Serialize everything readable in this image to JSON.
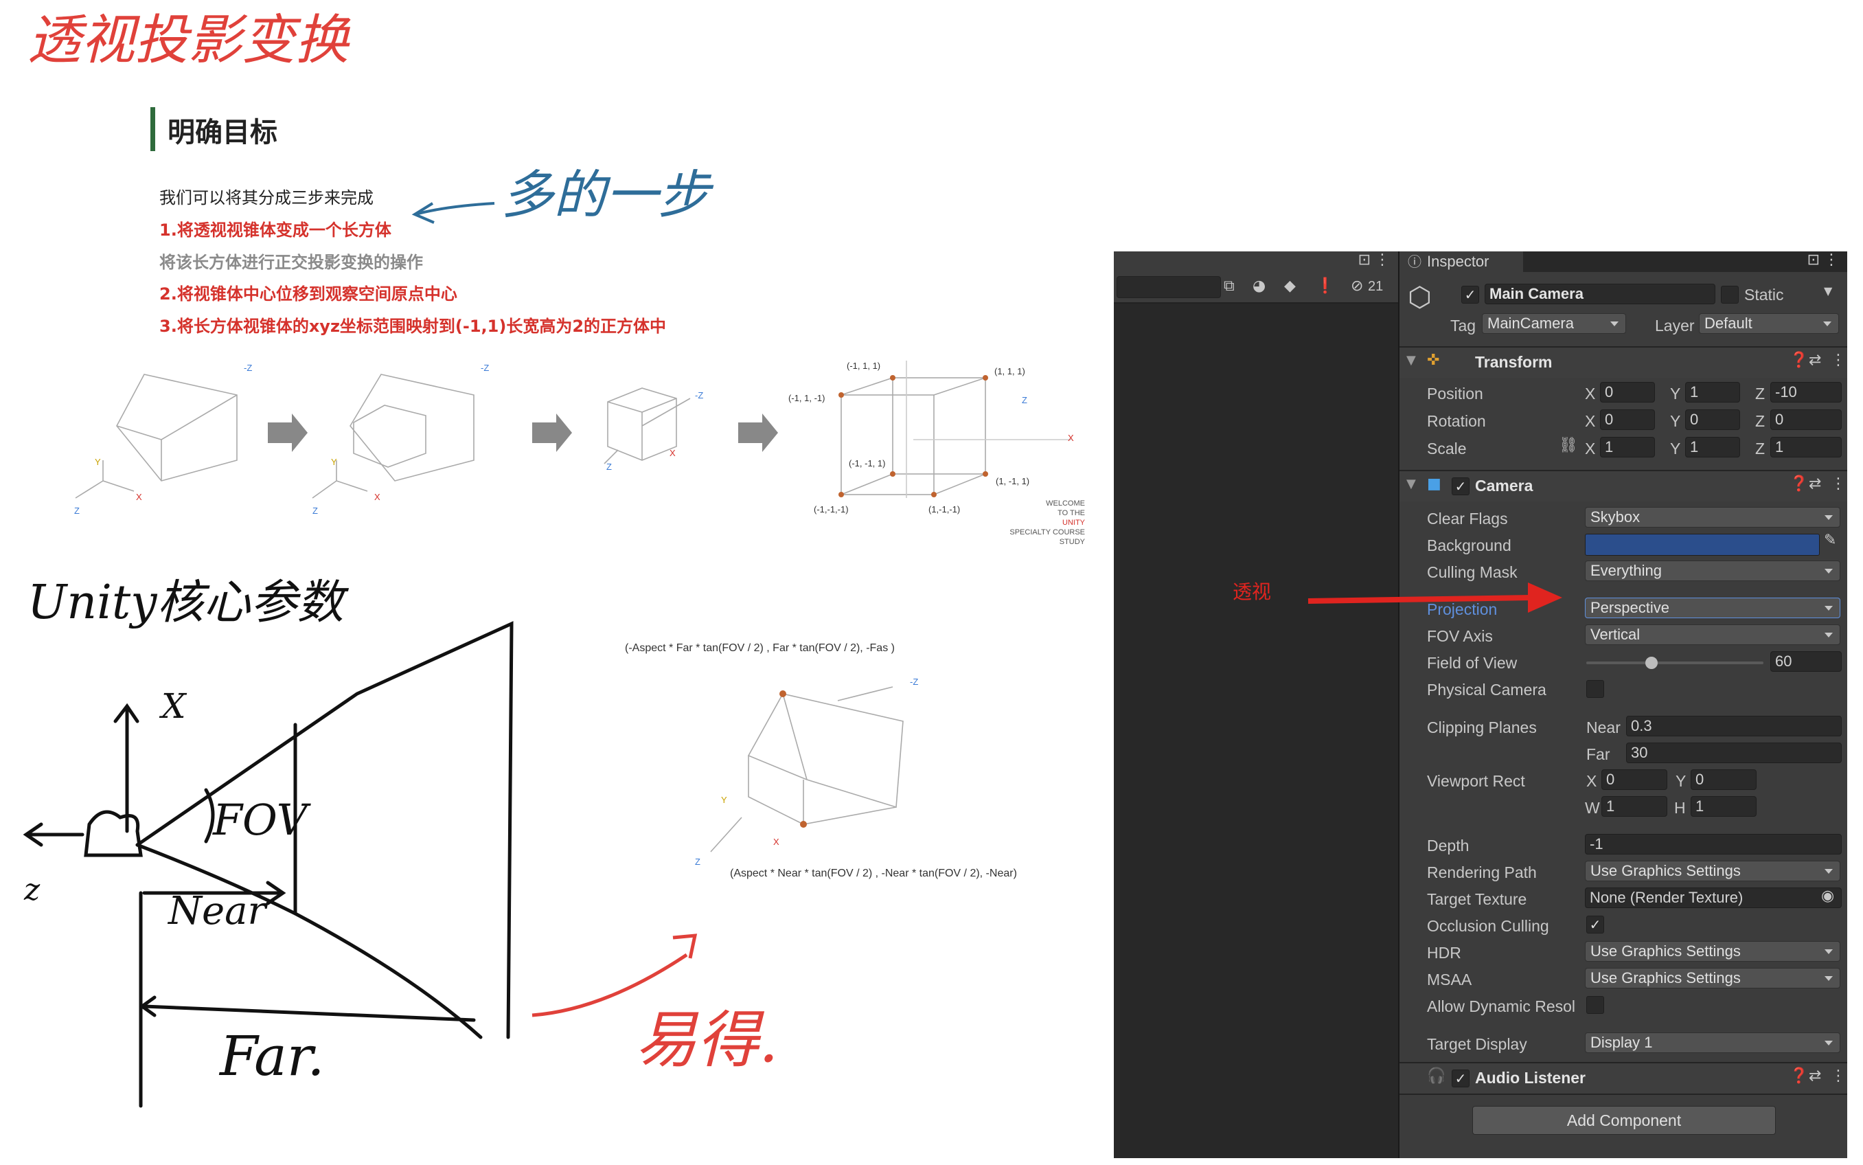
{
  "notes": {
    "title_handwritten": "透视投影变换",
    "extra_step": "多的一步",
    "unity_params": "Unity核心参数",
    "fov": "FOV",
    "near": "Near",
    "far": "Far.",
    "easy": "易得.",
    "perspective_tag": "透视",
    "axis_x": "X",
    "axis_z": "z"
  },
  "slide": {
    "title": "明确目标",
    "intro": "我们可以将其分成三步来完成",
    "steps": [
      "1.将透视视锥体变成一个长方体",
      "将该长方体进行正交投影变换的操作",
      "2.将视锥体中心位移到观察空间原点中心",
      "3.将长方体视锥体的xyz坐标范围映射到(-1,1)长宽高为2的正方体中"
    ],
    "cube_labels": [
      "(-1, 1, 1)",
      "(1, 1, 1)",
      "(-1, 1, -1)",
      "(-1, -1, 1)",
      "(1, -1, 1)",
      "(-1,-1,-1)",
      "(1,-1,-1)"
    ],
    "axis_labels": {
      "neg_z": "-Z",
      "z": "Z",
      "x": "X",
      "y": "Y"
    },
    "welcome": [
      "WELCOME",
      "TO THE",
      "UNITY",
      "SPECIALTY COURSE",
      "STUDY"
    ],
    "frustum_top_label": "(-Aspect * Far * tan(FOV / 2) , Far * tan(FOV / 2), -Fas )",
    "frustum_bottom_label": "(Aspect * Near * tan(FOV / 2) , -Near * tan(FOV / 2), -Near)"
  },
  "unity": {
    "hierarchy": {
      "visibility_count": "21"
    },
    "inspector": {
      "tab": "Inspector",
      "object": {
        "name": "Main Camera",
        "enabled": true,
        "static_label": "Static",
        "tag_label": "Tag",
        "tag": "MainCamera",
        "layer_label": "Layer",
        "layer": "Default"
      },
      "transform": {
        "title": "Transform",
        "position": {
          "label": "Position",
          "x": "0",
          "y": "1",
          "z": "-10"
        },
        "rotation": {
          "label": "Rotation",
          "x": "0",
          "y": "0",
          "z": "0"
        },
        "scale": {
          "label": "Scale",
          "x": "1",
          "y": "1",
          "z": "1"
        },
        "axis": {
          "x": "X",
          "y": "Y",
          "z": "Z"
        }
      },
      "camera": {
        "title": "Camera",
        "clear_flags": {
          "label": "Clear Flags",
          "value": "Skybox"
        },
        "background": {
          "label": "Background",
          "color": "#2b4e8c"
        },
        "culling_mask": {
          "label": "Culling Mask",
          "value": "Everything"
        },
        "projection": {
          "label": "Projection",
          "value": "Perspective"
        },
        "fov_axis": {
          "label": "FOV Axis",
          "value": "Vertical"
        },
        "field_of_view": {
          "label": "Field of View",
          "value": "60"
        },
        "physical_camera": {
          "label": "Physical Camera"
        },
        "clipping": {
          "label": "Clipping Planes",
          "near_label": "Near",
          "near": "0.3",
          "far_label": "Far",
          "far": "30"
        },
        "viewport": {
          "label": "Viewport Rect",
          "x_label": "X",
          "x": "0",
          "y_label": "Y",
          "y": "0",
          "w_label": "W",
          "w": "1",
          "h_label": "H",
          "h": "1"
        },
        "depth": {
          "label": "Depth",
          "value": "-1"
        },
        "rendering_path": {
          "label": "Rendering Path",
          "value": "Use Graphics Settings"
        },
        "target_texture": {
          "label": "Target Texture",
          "value": "None (Render Texture)"
        },
        "occlusion_culling": {
          "label": "Occlusion Culling"
        },
        "hdr": {
          "label": "HDR",
          "value": "Use Graphics Settings"
        },
        "msaa": {
          "label": "MSAA",
          "value": "Use Graphics Settings"
        },
        "dynamic_res": {
          "label": "Allow Dynamic Resol"
        },
        "target_display": {
          "label": "Target Display",
          "value": "Display 1"
        }
      },
      "audio_listener": {
        "title": "Audio Listener"
      },
      "add_component": "Add Component"
    }
  }
}
